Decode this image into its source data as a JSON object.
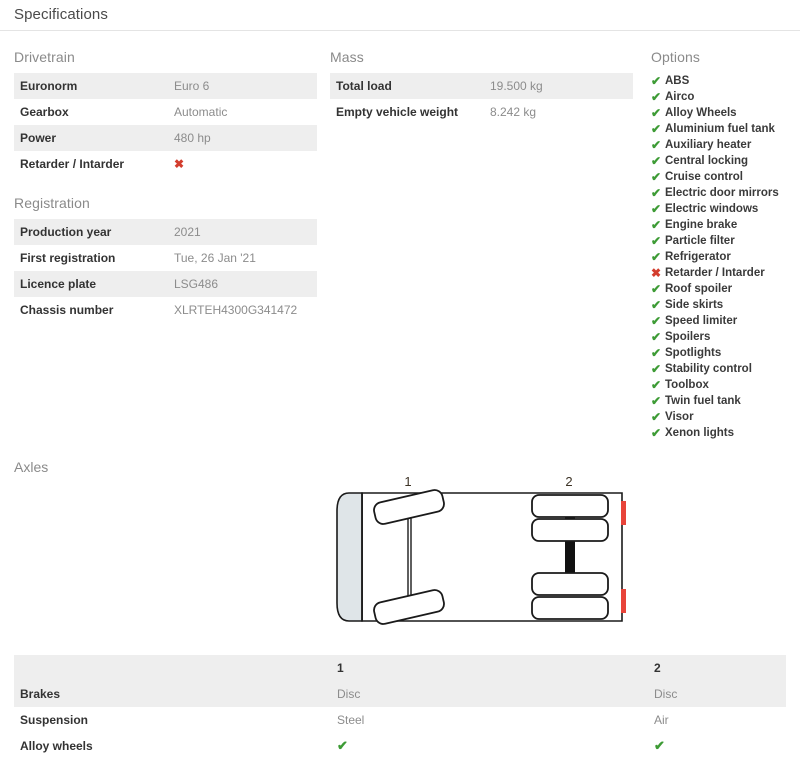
{
  "header": {
    "title": "Specifications"
  },
  "drivetrain": {
    "heading": "Drivetrain",
    "rows": [
      {
        "label": "Euronorm",
        "value": "Euro 6",
        "type": "text"
      },
      {
        "label": "Gearbox",
        "value": "Automatic",
        "type": "text"
      },
      {
        "label": "Power",
        "value": "480 hp",
        "type": "text"
      },
      {
        "label": "Retarder / Intarder",
        "value": "✖",
        "type": "cross"
      }
    ]
  },
  "registration": {
    "heading": "Registration",
    "rows": [
      {
        "label": "Production year",
        "value": "2021",
        "type": "text"
      },
      {
        "label": "First registration",
        "value": "Tue, 26 Jan '21",
        "type": "text"
      },
      {
        "label": "Licence plate",
        "value": "LSG486",
        "type": "text"
      },
      {
        "label": "Chassis number",
        "value": "XLRTEH4300G341472",
        "type": "text"
      }
    ]
  },
  "mass": {
    "heading": "Mass",
    "rows": [
      {
        "label": "Total load",
        "value": "19.500 kg",
        "type": "text"
      },
      {
        "label": "Empty vehicle weight",
        "value": "8.242 kg",
        "type": "text"
      }
    ]
  },
  "options": {
    "heading": "Options",
    "mark_yes": "✔",
    "mark_no": "✖",
    "items": [
      {
        "label": "ABS",
        "present": true
      },
      {
        "label": "Airco",
        "present": true
      },
      {
        "label": "Alloy Wheels",
        "present": true
      },
      {
        "label": "Aluminium fuel tank",
        "present": true
      },
      {
        "label": "Auxiliary heater",
        "present": true
      },
      {
        "label": "Central locking",
        "present": true
      },
      {
        "label": "Cruise control",
        "present": true
      },
      {
        "label": "Electric door mirrors",
        "present": true
      },
      {
        "label": "Electric windows",
        "present": true
      },
      {
        "label": "Engine brake",
        "present": true
      },
      {
        "label": "Particle filter",
        "present": true
      },
      {
        "label": "Refrigerator",
        "present": true
      },
      {
        "label": "Retarder / Intarder",
        "present": false
      },
      {
        "label": "Roof spoiler",
        "present": true
      },
      {
        "label": "Side skirts",
        "present": true
      },
      {
        "label": "Speed limiter",
        "present": true
      },
      {
        "label": "Spoilers",
        "present": true
      },
      {
        "label": "Spotlights",
        "present": true
      },
      {
        "label": "Stability control",
        "present": true
      },
      {
        "label": "Toolbox",
        "present": true
      },
      {
        "label": "Twin fuel tank",
        "present": true
      },
      {
        "label": "Visor",
        "present": true
      },
      {
        "label": "Xenon lights",
        "present": true
      }
    ]
  },
  "axles": {
    "heading": "Axles",
    "diagram": {
      "axle_1_label": "1",
      "axle_2_label": "2"
    },
    "table": {
      "columns": [
        "",
        "1",
        "2"
      ],
      "rows": [
        {
          "label": "Brakes",
          "a1": "Disc",
          "a2": "Disc",
          "type": "text"
        },
        {
          "label": "Suspension",
          "a1": "Steel",
          "a2": "Air",
          "type": "text"
        },
        {
          "label": "Alloy wheels",
          "a1": "✔",
          "a2": "✔",
          "type": "tick"
        }
      ]
    }
  },
  "colors": {
    "row_gray": "#eeeeee",
    "value_text": "#8c8c8c",
    "heading_text": "#8a8a8a",
    "check_green": "#3d9b35",
    "cross_red": "#d33d2e",
    "taillight_red": "#e8443a"
  }
}
